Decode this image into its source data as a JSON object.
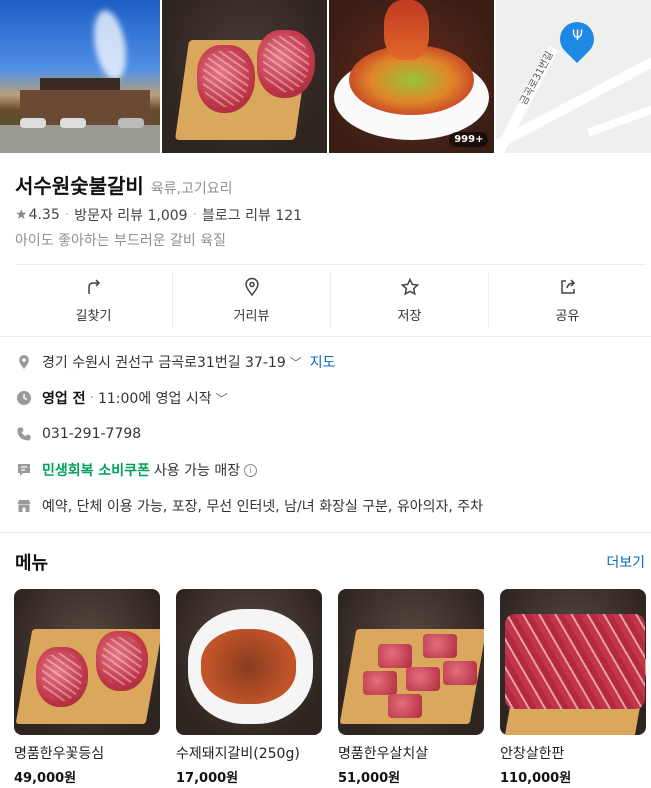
{
  "gallery": {
    "photo_count_badge": "999+",
    "map_street_label": "금곡로31번길"
  },
  "place": {
    "name": "서수원숯불갈비",
    "category": "육류,고기요리",
    "rating_star": "★",
    "rating": "4.35",
    "visitor_reviews": "방문자 리뷰 1,009",
    "blog_reviews": "블로그 리뷰 121",
    "tagline": "아이도 좋아하는 부드러운 갈비 육질"
  },
  "actions": [
    {
      "label": "길찾기",
      "icon": "directions-icon"
    },
    {
      "label": "거리뷰",
      "icon": "street-view-icon"
    },
    {
      "label": "저장",
      "icon": "star-icon"
    },
    {
      "label": "공유",
      "icon": "share-icon"
    }
  ],
  "info": {
    "address": "경기 수원시 권선구 금곡로31번길 37-19",
    "map_link": "지도",
    "hours_status": "영업 전",
    "hours_detail": "11:00에 영업 시작",
    "phone": "031-291-7798",
    "coupon_highlight": "민생회복 소비쿠폰",
    "coupon_rest": "사용 가능 매장",
    "amenities": "예약, 단체 이용 가능, 포장, 무선 인터넷, 남/녀 화장실 구분, 유아의자, 주차"
  },
  "menu": {
    "title": "메뉴",
    "more": "더보기",
    "items": [
      {
        "name": "명품한우꽃등심",
        "price": "49,000원"
      },
      {
        "name": "수제돼지갈비(250g)",
        "price": "17,000원"
      },
      {
        "name": "명품한우살치살",
        "price": "51,000원"
      },
      {
        "name": "안창살한판",
        "price": "110,000원"
      }
    ]
  },
  "colors": {
    "link_blue": "#0068c3",
    "coupon_green": "#03a05c",
    "map_pin_blue": "#1e88e5"
  }
}
